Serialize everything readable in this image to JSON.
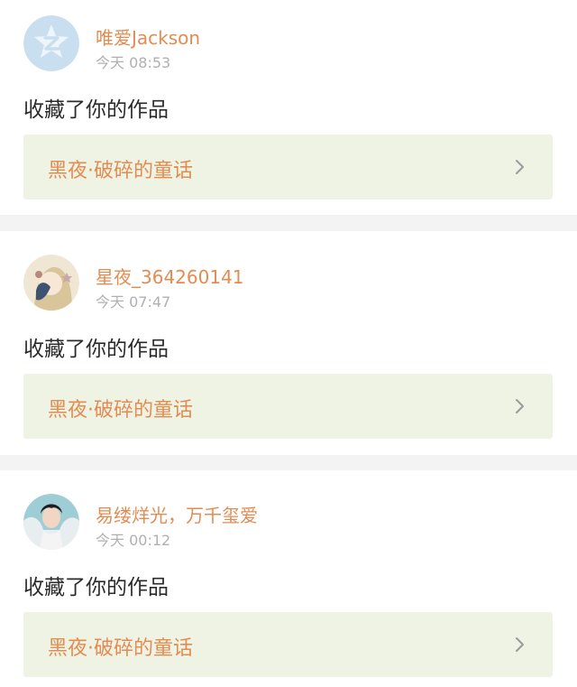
{
  "notifications": [
    {
      "avatar_icon": "qq-z-logo-avatar",
      "username": "唯爱Jackson",
      "time": "今天 08:53",
      "action": "收藏了你的作品",
      "work_title": "黑夜·破碎的童话",
      "chevron_icon": "chevron-right-icon"
    },
    {
      "avatar_icon": "anime-girl-avatar",
      "username": "星夜_364260141",
      "time": "今天 07:47",
      "action": "收藏了你的作品",
      "work_title": "黑夜·破碎的童话",
      "chevron_icon": "chevron-right-icon"
    },
    {
      "avatar_icon": "portrait-photo-avatar",
      "username": "易缕烊光，万千玺爱",
      "time": "今天 00:12",
      "action": "收藏了你的作品",
      "work_title": "黑夜·破碎的童话",
      "chevron_icon": "chevron-right-icon"
    }
  ],
  "colors": {
    "accent_orange": "#e38c52",
    "work_box_bg": "#eff3e4",
    "separator": "#f3f3f3",
    "time_gray": "#b0b0b0",
    "action_text": "#2b2b2b"
  }
}
